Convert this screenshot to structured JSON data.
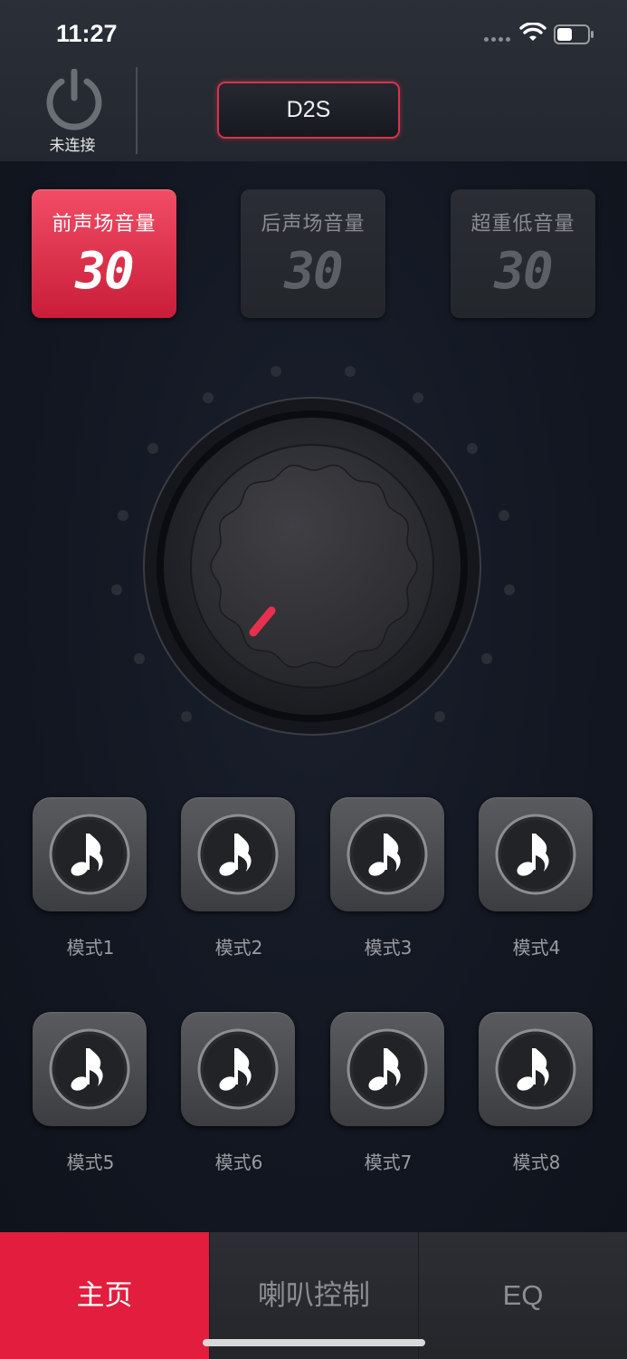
{
  "status_bar": {
    "time": "11:27"
  },
  "header": {
    "power_label": "未连接",
    "device_name": "D2S"
  },
  "volumes": [
    {
      "title": "前声场音量",
      "value": "30",
      "active": true
    },
    {
      "title": "后声场音量",
      "value": "30",
      "active": false
    },
    {
      "title": "超重低音量",
      "value": "30",
      "active": false
    }
  ],
  "knob": {
    "indicator_color": "#e8304c"
  },
  "modes": [
    {
      "label": "模式1"
    },
    {
      "label": "模式2"
    },
    {
      "label": "模式3"
    },
    {
      "label": "模式4"
    },
    {
      "label": "模式5"
    },
    {
      "label": "模式6"
    },
    {
      "label": "模式7"
    },
    {
      "label": "模式8"
    }
  ],
  "tabs": [
    {
      "label": "主页",
      "active": true
    },
    {
      "label": "喇叭控制",
      "active": false
    },
    {
      "label": "EQ",
      "active": false
    }
  ],
  "colors": {
    "accent": "#e21d3d",
    "background": "#11151e"
  },
  "icons": {
    "power": "power-icon",
    "mode": "music-note-icon",
    "wifi": "wifi-icon",
    "battery": "battery-icon"
  }
}
